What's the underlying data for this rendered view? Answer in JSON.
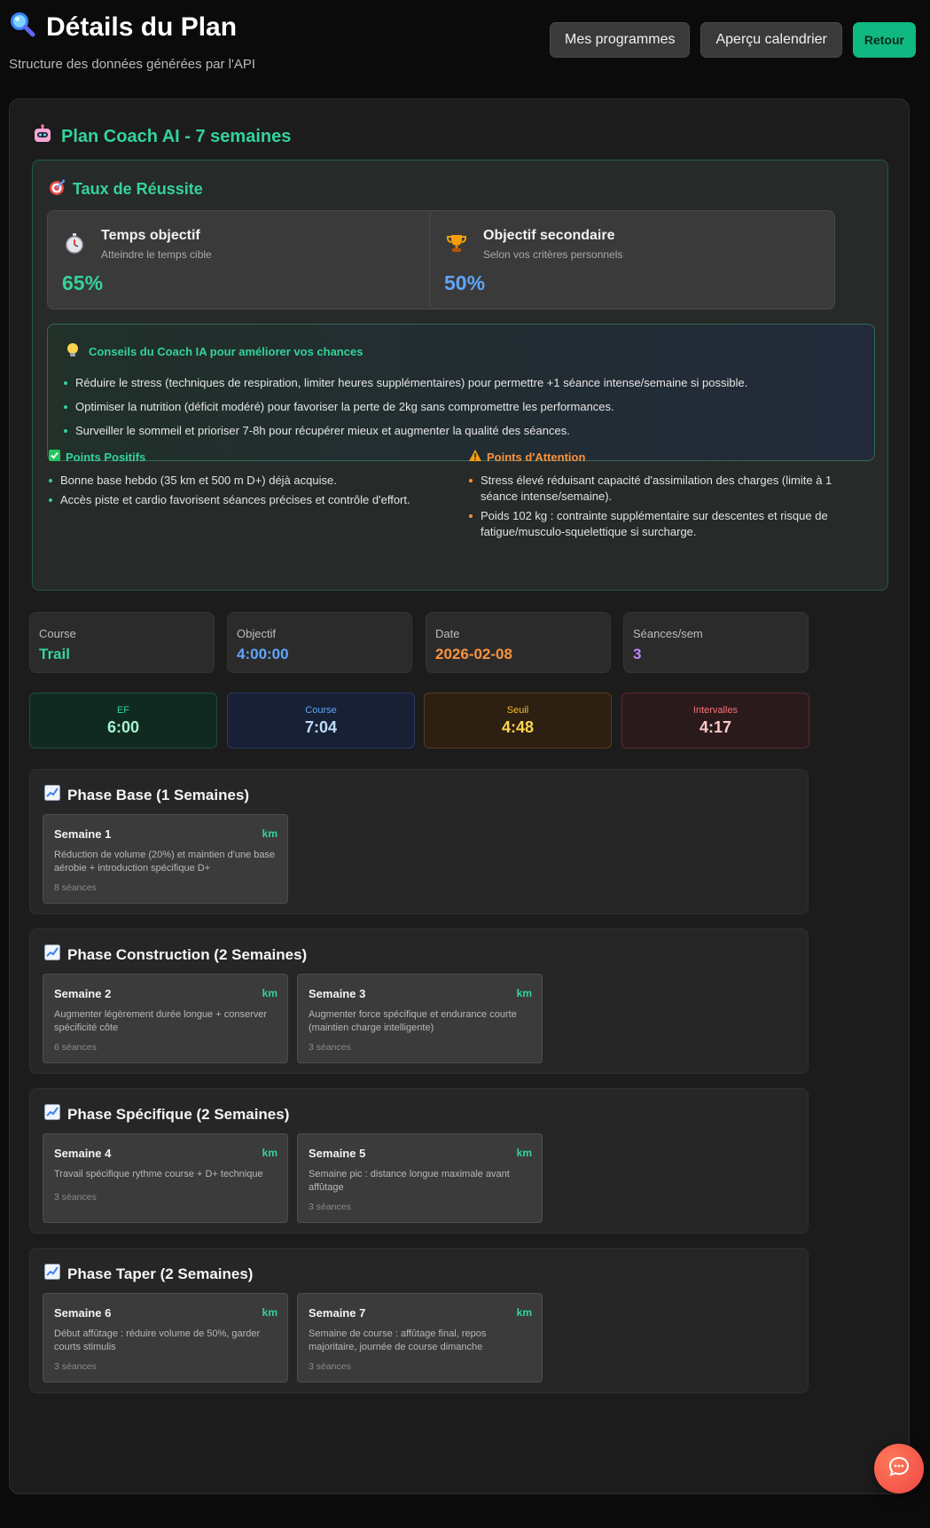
{
  "header": {
    "title": "Détails du Plan",
    "subtitle": "Structure des données générées par l'API",
    "buttons": {
      "programs": "Mes programmes",
      "calendar": "Aperçu calendrier",
      "back": "Retour"
    }
  },
  "plan": {
    "title": "Plan Coach AI - 7 semaines"
  },
  "success": {
    "title": "Taux de Réussite",
    "primary": {
      "label": "Temps objectif",
      "sub": "Atteindre le temps cible",
      "value": "65%",
      "color": "#34d399"
    },
    "secondary": {
      "label": "Objectif secondaire",
      "sub": "Selon vos critères personnels",
      "value": "50%",
      "color": "#60a5fa"
    },
    "tips": {
      "title": "Conseils du Coach IA pour améliorer vos chances",
      "items": [
        "Réduire le stress (techniques de respiration, limiter heures supplémentaires) pour permettre +1 séance intense/semaine si possible.",
        "Optimiser la nutrition (déficit modéré) pour favoriser la perte de 2kg sans compromettre les performances.",
        "Surveiller le sommeil et prioriser 7-8h pour récupérer mieux et augmenter la qualité des séances."
      ]
    },
    "positives": {
      "title": "Points Positifs",
      "items": [
        "Bonne base hebdo (35 km et 500 m D+) déjà acquise.",
        "Accès piste et cardio favorisent séances précises et contrôle d'effort."
      ]
    },
    "attention": {
      "title": "Points d'Attention",
      "items": [
        "Stress élevé réduisant capacité d'assimilation des charges (limite à 1 séance intense/semaine).",
        "Poids 102 kg : contrainte supplémentaire sur descentes et risque de fatigue/musculo-squelettique si surcharge."
      ]
    }
  },
  "meta": [
    {
      "label": "Course",
      "value": "Trail",
      "color": "#34d399"
    },
    {
      "label": "Objectif",
      "value": "4:00:00",
      "color": "#60a5fa"
    },
    {
      "label": "Date",
      "value": "2026-02-08",
      "color": "#fb923c"
    },
    {
      "label": "Séances/sem",
      "value": "3",
      "color": "#c084fc"
    }
  ],
  "paces": [
    {
      "label": "EF",
      "value": "6:00"
    },
    {
      "label": "Course",
      "value": "7:04"
    },
    {
      "label": "Seuil",
      "value": "4:48"
    },
    {
      "label": "Intervalles",
      "value": "4:17"
    }
  ],
  "phases": [
    {
      "title": "Phase Base (1 Semaines)",
      "weeks": [
        {
          "name": "Semaine 1",
          "km": "km",
          "desc": "Réduction de volume (20%) et maintien d'une base aérobie + introduction spécifique D+",
          "sessions": "8 séances"
        }
      ]
    },
    {
      "title": "Phase Construction (2 Semaines)",
      "weeks": [
        {
          "name": "Semaine 2",
          "km": "km",
          "desc": "Augmenter légèrement durée longue + conserver spécificité côte",
          "sessions": "6 séances"
        },
        {
          "name": "Semaine 3",
          "km": "km",
          "desc": "Augmenter force spécifique et endurance courte (maintien charge intelligente)",
          "sessions": "3 séances"
        }
      ]
    },
    {
      "title": "Phase Spécifique (2 Semaines)",
      "weeks": [
        {
          "name": "Semaine 4",
          "km": "km",
          "desc": "Travail spécifique rythme course + D+ technique",
          "sessions": "3 séances"
        },
        {
          "name": "Semaine 5",
          "km": "km",
          "desc": "Semaine pic : distance longue maximale avant affûtage",
          "sessions": "3 séances"
        }
      ]
    },
    {
      "title": "Phase Taper (2 Semaines)",
      "weeks": [
        {
          "name": "Semaine 6",
          "km": "km",
          "desc": "Début affûtage : réduire volume de 50%, garder courts stimulis",
          "sessions": "3 séances"
        },
        {
          "name": "Semaine 7",
          "km": "km",
          "desc": "Semaine de course : affûtage final, repos majoritaire, journée de course dimanche",
          "sessions": "3 séances"
        }
      ]
    }
  ]
}
